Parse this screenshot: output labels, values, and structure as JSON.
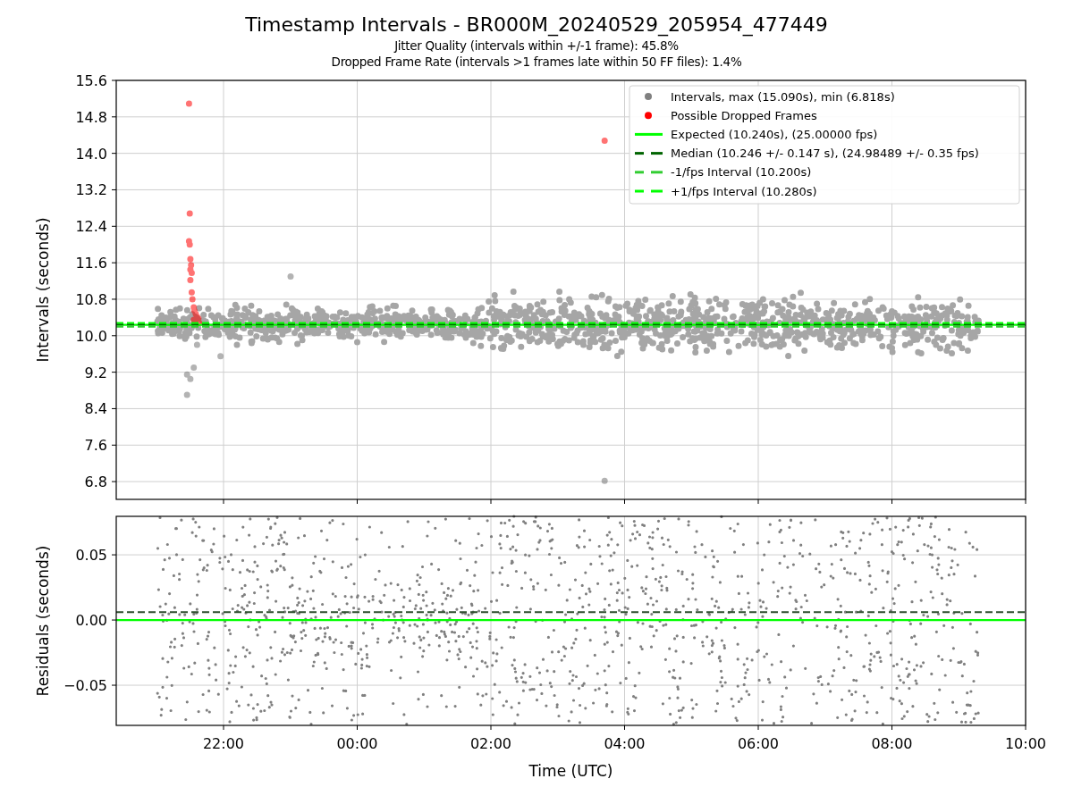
{
  "figure": {
    "title": "Timestamp Intervals - BR000M_20240529_205954_477449",
    "subtitles": [
      "Jitter Quality (intervals within +/-1 frame): 45.8%",
      "Dropped Frame Rate (intervals >1 frames late within 50 FF files): 1.4%"
    ]
  },
  "top_plot": {
    "y_axis_label": "Intervals (seconds)",
    "y_tick_labels": [
      "15.6",
      "14.8",
      "14.0",
      "13.2",
      "12.4",
      "11.6",
      "10.8",
      "10.0",
      "9.2",
      "8.4",
      "7.6",
      "6.8"
    ],
    "legend": [
      {
        "kind": "marker",
        "label": "Intervals, max (15.090s), min (6.818s)",
        "color": "#808080"
      },
      {
        "kind": "marker",
        "label": "Possible Dropped Frames",
        "color": "#ff0000"
      },
      {
        "kind": "line",
        "label": "Expected (10.240s), (25.00000 fps)",
        "color": "#00ff00"
      },
      {
        "kind": "dashed",
        "label": "Median (10.246 +/- 0.147 s), (24.98489 +/- 0.35 fps)",
        "color": "#006400"
      },
      {
        "kind": "dashed",
        "label": "-1/fps Interval (10.200s)",
        "color": "#32cd32"
      },
      {
        "kind": "dashed",
        "label": "+1/fps Interval (10.280s)",
        "color": "#00ff00"
      }
    ]
  },
  "bottom_plot": {
    "y_axis_label": "Residuals (seconds)",
    "y_tick_labels": [
      "0.05",
      "0.00",
      "−0.05"
    ],
    "x_tick_labels": [
      "22:00",
      "00:00",
      "02:00",
      "04:00",
      "06:00",
      "08:00",
      "10:00"
    ],
    "x_axis_label": "Time (UTC)"
  }
}
